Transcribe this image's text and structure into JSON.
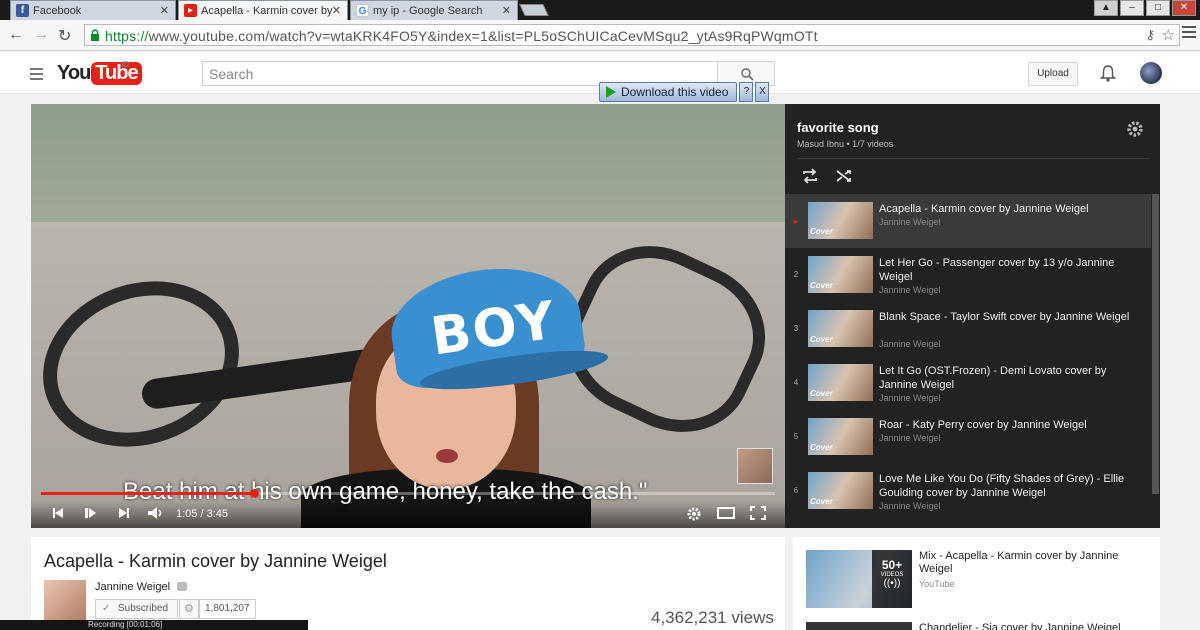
{
  "browser": {
    "tabs": [
      {
        "label": "Facebook",
        "icon": "facebook-icon",
        "active": false
      },
      {
        "label": "Acapella - Karmin cover by",
        "icon": "youtube-icon",
        "active": true
      },
      {
        "label": "my ip - Google Search",
        "icon": "google-icon",
        "active": false
      }
    ],
    "url_proto": "https://",
    "url_rest": "www.youtube.com/watch?v=wtaKRK4FO5Y&index=1&list=PL5oSChUICaCevMSqu2_ytAs9RqPWqmOTt"
  },
  "masthead": {
    "logo_you": "You",
    "logo_tube": "Tube",
    "region": "ID",
    "search_placeholder": "Search",
    "upload_label": "Upload"
  },
  "download_widget": {
    "label": "Download this video",
    "help": "?",
    "close": "X"
  },
  "player": {
    "cap_text": "BOY",
    "caption": "Beat him at his own game, honey, take the cash.\"",
    "time": "1:05 / 3:45",
    "progress": 0.29
  },
  "playlist": {
    "title": "favorite song",
    "subtitle": "Masud Ibnu • 1/7 videos",
    "items": [
      {
        "num": "▸",
        "title": "Acapella - Karmin cover by Jannine Weigel",
        "owner": "Jannine Weigel",
        "active": true
      },
      {
        "num": "2",
        "title": "Let Her Go - Passenger cover by 13 y/o Jannine Weigel",
        "owner": "Jannine Weigel",
        "active": false
      },
      {
        "num": "3",
        "title": "Blank Space - Taylor Swift cover by Jannine Weigel",
        "owner": "Jannine Weigel",
        "active": false
      },
      {
        "num": "4",
        "title": "Let It Go (OST.Frozen) - Demi Lovato cover by Jannine Weigel",
        "owner": "Jannine Weigel",
        "active": false
      },
      {
        "num": "5",
        "title": "Roar - Katy Perry cover by Jannine Weigel",
        "owner": "Jannine Weigel",
        "active": false
      },
      {
        "num": "6",
        "title": "Love Me Like You Do (Fifty Shades of Grey) - Ellie Goulding cover by Jannine Weigel",
        "owner": "Jannine Weigel",
        "active": false
      }
    ],
    "thumb_badge": "Cover"
  },
  "video_info": {
    "title": "Acapella - Karmin cover by Jannine Weigel",
    "channel": "Jannine Weigel",
    "subscribed_label": "Subscribed",
    "subscriber_count": "1,801,207",
    "views": "4,362,231 views"
  },
  "related": {
    "items": [
      {
        "title": "Mix - Acapella - Karmin cover by Jannine Weigel",
        "owner": "YouTube",
        "count": "50+",
        "count_label": "VIDEOS"
      },
      {
        "title": "Chandelier - Sia cover by Jannine Weigel"
      }
    ]
  },
  "taskbar": {
    "recording": "Recording [00:01:06]"
  }
}
